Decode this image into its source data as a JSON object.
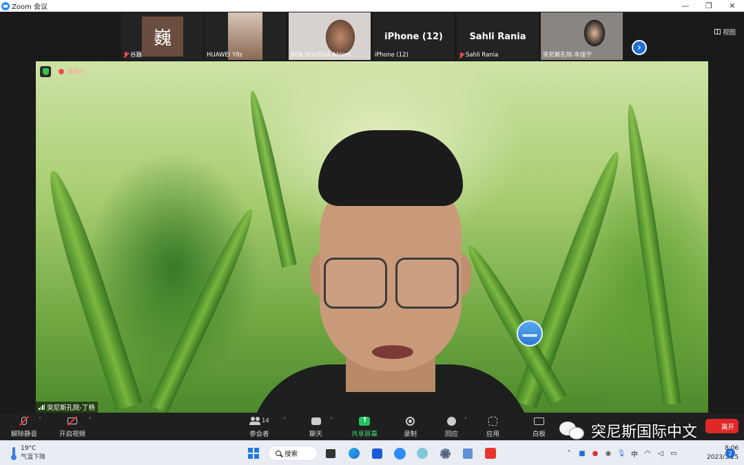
{
  "window": {
    "title": "Zoom 会议",
    "controls": [
      "—",
      "❐",
      "✕"
    ]
  },
  "gallery": {
    "view_label": "视图",
    "participants": [
      {
        "name": "谷巍",
        "avatar_text": "巍",
        "muted": true
      },
      {
        "name": "HUAWEI Y8s",
        "muted": false
      },
      {
        "name": "BEN SOUSSIA Ahlem",
        "muted": false
      },
      {
        "name": "iPhone (12)",
        "display_name": "iPhone (12)",
        "muted": false
      },
      {
        "name": "Sahli Rania",
        "display_name": "Sahli Rania",
        "muted": true
      },
      {
        "name": "突尼斯孔院-车佳宁",
        "muted": false
      }
    ],
    "next_arrow": "›"
  },
  "main_video": {
    "recording_label": "录制中",
    "speaker_name": "突尼斯孔院-丁杨"
  },
  "toolbar": {
    "unmute": "解除静音",
    "start_video": "开启视频",
    "participants": "参会者",
    "participants_count": "14",
    "chat": "聊天",
    "share_screen": "共享屏幕",
    "record": "录制",
    "reactions": "回应",
    "apps": "应用",
    "whiteboard": "白板",
    "leave": "离开"
  },
  "watermark": {
    "text": "突尼斯国际中文"
  },
  "taskbar": {
    "weather_temp": "19°C",
    "weather_desc": "气温下降",
    "search_label": "搜索",
    "ime_label": "中",
    "time": "8:06",
    "date": "2023/3/25",
    "notification_count": "2"
  },
  "colors": {
    "accent_blue": "#2d8cff",
    "share_green": "#20c35a",
    "leave_red": "#e02828",
    "mute_red": "#ff4d4f"
  }
}
